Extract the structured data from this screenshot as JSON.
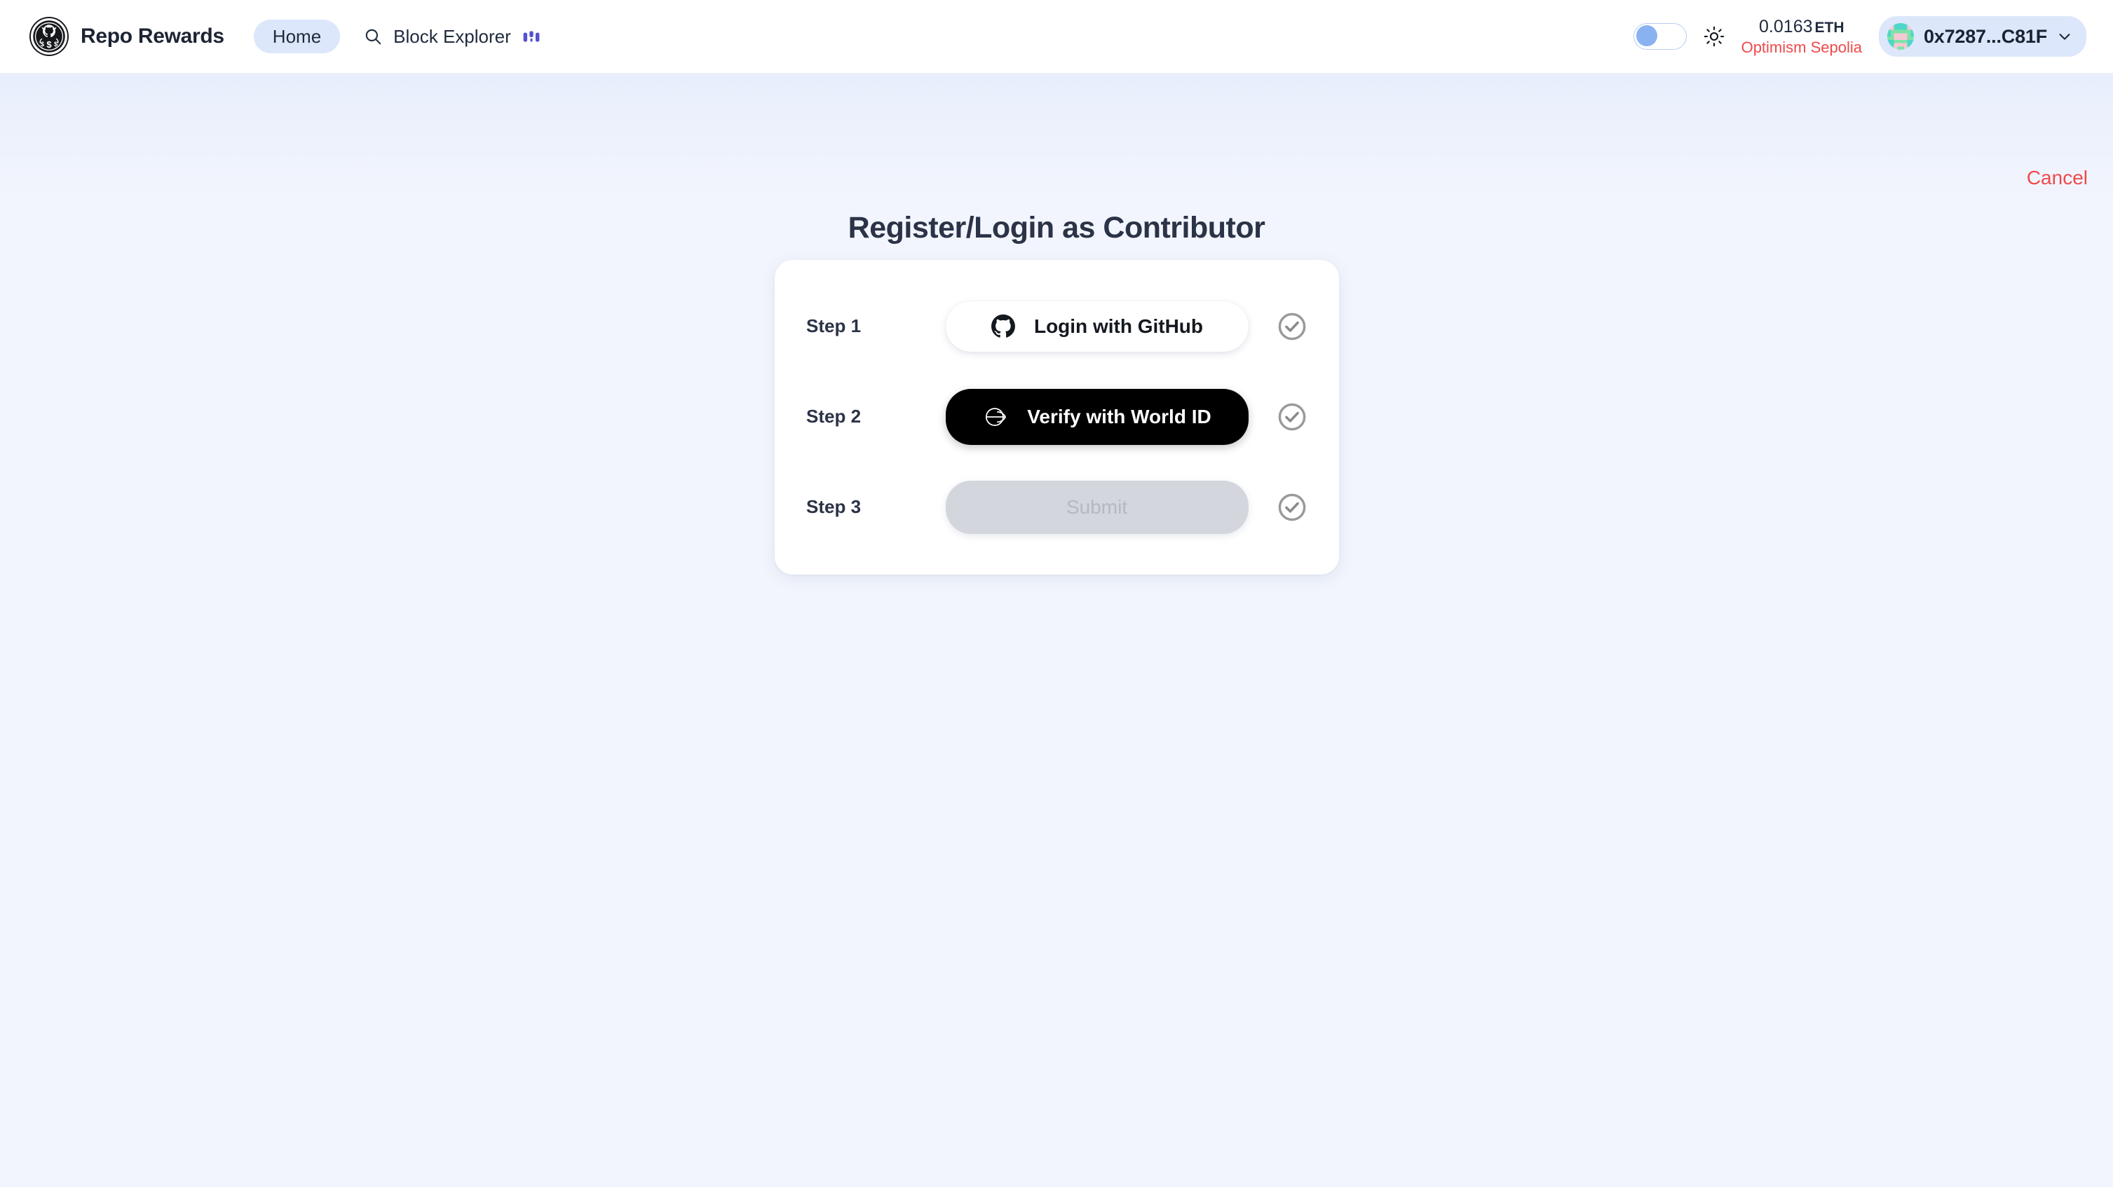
{
  "header": {
    "logo_icon": "repo-rewards-coin-logo",
    "brand_name": "Repo Rewards",
    "nav": {
      "home_label": "Home",
      "block_explorer_label": "Block Explorer",
      "search_icon": "search-icon",
      "blockscout_icon": "blockscout-icon"
    },
    "theme_toggle": {
      "state": "off",
      "knob_color": "#8ab2f0",
      "sun_icon": "sun-icon"
    },
    "balance": {
      "amount": "0.0163",
      "unit": "ETH",
      "network": "Optimism Sepolia",
      "network_color": "#ef4a4a"
    },
    "wallet": {
      "avatar_icon": "blockie-avatar",
      "address": "0x7287...C81F",
      "chevron_icon": "chevron-down-icon",
      "pill_color": "#dce7fb"
    }
  },
  "main": {
    "cancel_label": "Cancel",
    "cancel_color": "#ef4a4a",
    "title": "Register/Login as Contributor",
    "steps": [
      {
        "label": "Step 1",
        "button_label": "Login with GitHub",
        "button_icon": "github-icon",
        "button_state": "enabled",
        "status_icon": "check-circle-icon"
      },
      {
        "label": "Step 2",
        "button_label": "Verify with World ID",
        "button_icon": "world-id-icon",
        "button_state": "enabled",
        "status_icon": "check-circle-icon"
      },
      {
        "label": "Step 3",
        "button_label": "Submit",
        "button_icon": "",
        "button_state": "disabled",
        "status_icon": "check-circle-icon"
      }
    ]
  },
  "colors": {
    "page_background": "#f2f5fd",
    "card_background": "#ffffff",
    "accent_blue": "#dce7fb",
    "danger_red": "#ef4a4a",
    "text_dark": "#2b3347"
  }
}
